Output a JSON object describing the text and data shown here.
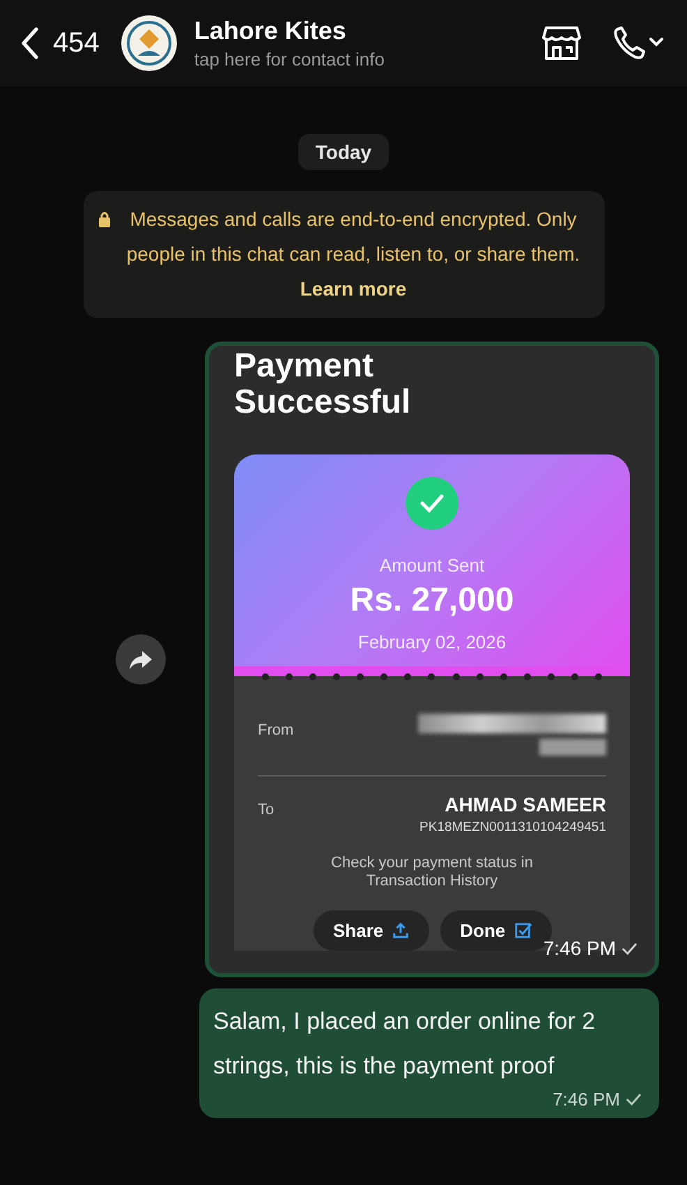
{
  "header": {
    "back_count": "454",
    "name": "Lahore  Kites",
    "subtitle": "tap here for contact info"
  },
  "date_chip": "Today",
  "encryption_notice": {
    "text": "Messages and calls are end-to-end encrypted. Only people in this chat can read, listen to, or share them.",
    "link": "Learn more"
  },
  "messages": [
    {
      "kind": "image",
      "time": "7:46 PM",
      "read": false,
      "receipt": {
        "title": "Payment Successful",
        "amount_label": "Amount Sent",
        "amount": "Rs. 27,000",
        "date": "February 02, 2026",
        "from_label": "From",
        "to_label": "To",
        "to_name": "AHMAD SAMEER",
        "to_account": "PK18MEZN0011310104249451",
        "status_note": "Check your payment status in Transaction History",
        "buttons": [
          {
            "label": "Share",
            "kind": "share"
          },
          {
            "label": "Done",
            "kind": "done"
          }
        ]
      }
    },
    {
      "kind": "text",
      "time": "7:46 PM",
      "read": false,
      "text": "Salam, I placed an order online for 2 strings, this is the payment proof"
    }
  ]
}
